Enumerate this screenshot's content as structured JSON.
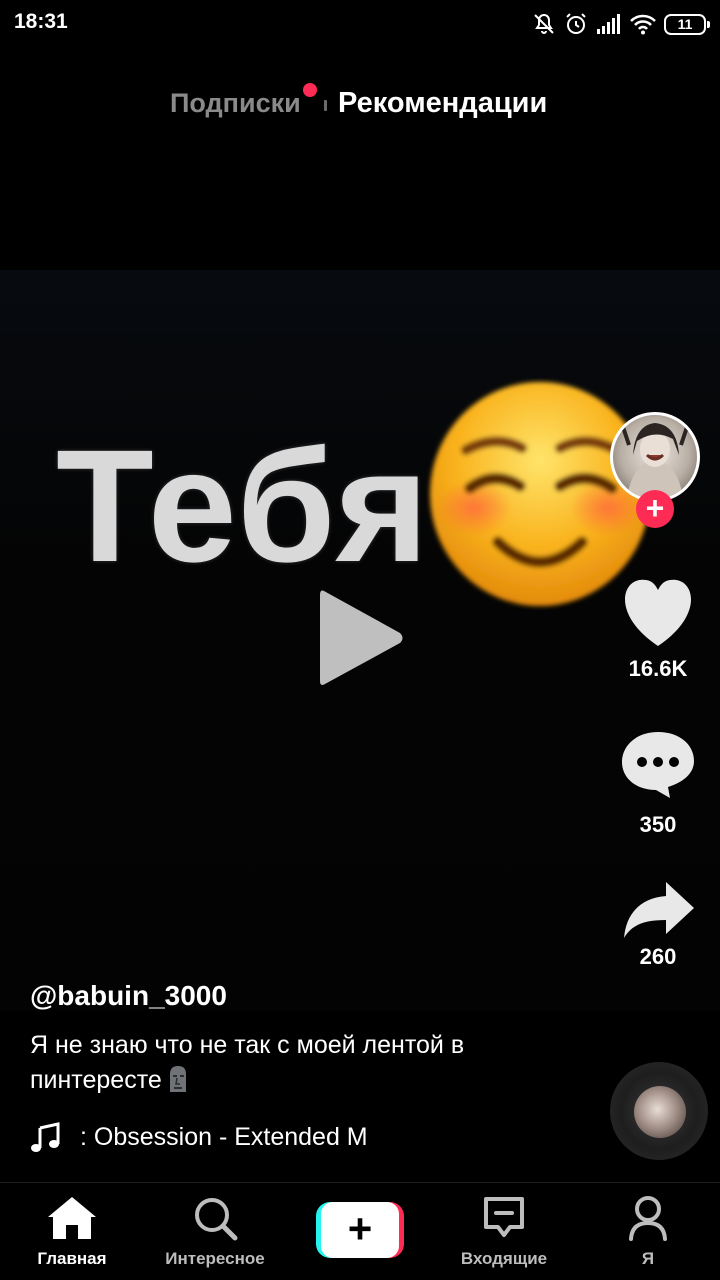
{
  "status_bar": {
    "time": "18:31",
    "battery": "11",
    "icons": [
      "muted-bell-icon",
      "alarm-icon",
      "signal-icon",
      "wifi-icon",
      "battery-icon"
    ]
  },
  "top_tabs": {
    "following_label": "Подписки",
    "for_you_label": "Рекомендации",
    "following_has_new": true
  },
  "video": {
    "overlay_text": "Тебя",
    "emoji": "smiling-blushing-face",
    "state": "paused"
  },
  "actions": {
    "likes": "16.6K",
    "comments": "350",
    "shares": "260"
  },
  "post": {
    "username": "@babuin_3000",
    "caption": "Я не знаю что не так с моей лентой в пинтересте",
    "caption_emoji": "moai-icon",
    "music": ": Obsession - Extended M"
  },
  "bottom_nav": {
    "home": "Главная",
    "discover": "Интересное",
    "inbox": "Входящие",
    "me": "Я",
    "create": "+"
  },
  "colors": {
    "accent": "#fe2c55",
    "cyan": "#25f4ee",
    "background": "#000000",
    "inactive_tab": "#8a8a8a"
  }
}
